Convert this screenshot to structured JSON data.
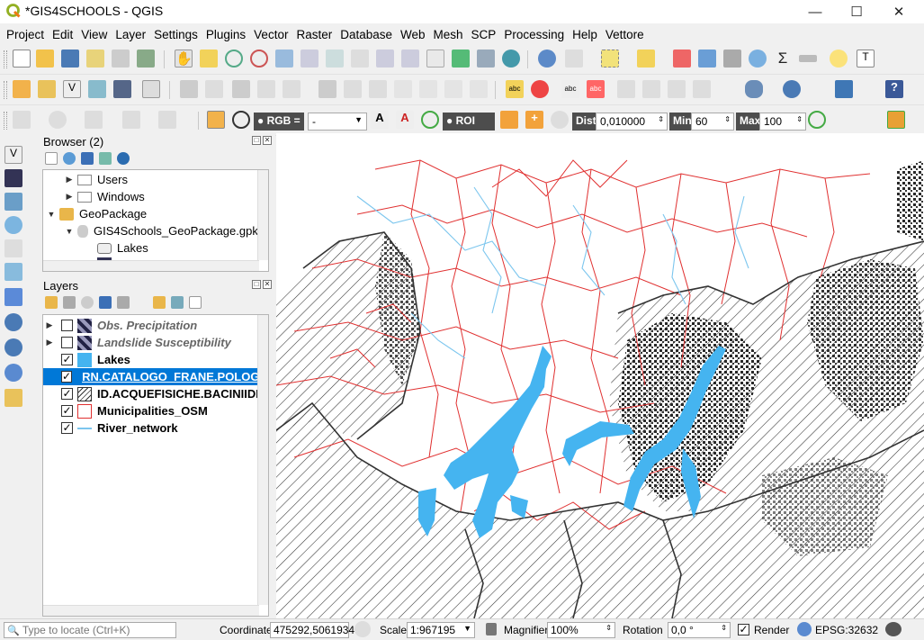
{
  "window": {
    "title": "*GIS4SCHOOLS - QGIS"
  },
  "menu": [
    "Project",
    "Edit",
    "View",
    "Layer",
    "Settings",
    "Plugins",
    "Vector",
    "Raster",
    "Database",
    "Web",
    "Mesh",
    "SCP",
    "Processing",
    "Help",
    "Vettore"
  ],
  "scp_toolbar": {
    "rgb_label": "RGB =",
    "rgb_value": "-",
    "roi_label": "ROI",
    "dist_label": "Dist",
    "dist_value": "0,010000",
    "min_label": "Min",
    "min_value": "60",
    "max_label": "Max",
    "max_value": "100"
  },
  "browser": {
    "title": "Browser (2)",
    "items": [
      {
        "label": "Users",
        "indent": 1,
        "icon": "folder-icon"
      },
      {
        "label": "Windows",
        "indent": 1,
        "icon": "folder-icon"
      },
      {
        "label": "GeoPackage",
        "indent": 0,
        "icon": "geopackage-icon"
      },
      {
        "label": "GIS4Schools_GeoPackage.gpkg",
        "indent": 1,
        "icon": "database-icon"
      },
      {
        "label": "Lakes",
        "indent": 2,
        "icon": "polygon-layer-icon"
      }
    ]
  },
  "layers": {
    "title": "Layers",
    "items": [
      {
        "label": "Obs. Precipitation",
        "checked": false,
        "style": "italic-gray",
        "swatch": "raster"
      },
      {
        "label": "Landslide Susceptibility",
        "checked": false,
        "style": "italic-gray",
        "swatch": "raster"
      },
      {
        "label": "Lakes",
        "checked": true,
        "style": "bold",
        "swatch": "#45b4f0"
      },
      {
        "label": "RN.CATALOGO_FRANE.POLOGO",
        "checked": true,
        "style": "selected",
        "swatch": "#9b6a90"
      },
      {
        "label": "ID.ACQUEFISICHE.BACINIIDROG",
        "checked": true,
        "style": "bold",
        "swatch": "hatch"
      },
      {
        "label": "Municipalities_OSM",
        "checked": true,
        "style": "bold",
        "swatch": "red-outline"
      },
      {
        "label": "River_network",
        "checked": true,
        "style": "bold",
        "swatch": "line"
      }
    ]
  },
  "statusbar": {
    "locate_placeholder": "Type to locate (Ctrl+K)",
    "coordinate_label": "Coordinate",
    "coordinate_value": "475292,5061934",
    "scale_label": "Scale",
    "scale_value": "1:967195",
    "magnifier_label": "Magnifier",
    "magnifier_value": "100%",
    "rotation_label": "Rotation",
    "rotation_value": "0,0 °",
    "render_label": "Render",
    "epsg": "EPSG:32632"
  },
  "colors": {
    "lakes": "#45b4f0",
    "municipalities": "#e03030",
    "rivers": "#7cc6ee",
    "landslides": "#1a1a1a",
    "selection": "#0078d7"
  }
}
